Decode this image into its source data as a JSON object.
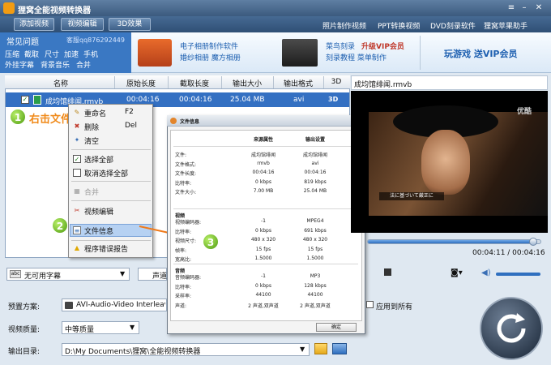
{
  "app": {
    "title": "狸窝全能视频转换器"
  },
  "menubar": {
    "tabs": [
      "添加视频",
      "视频编辑",
      "3D效果"
    ],
    "links": [
      "照片制作视频",
      "PPT转换视频",
      "DVD刻录软件",
      "狸窝苹果助手"
    ]
  },
  "banner": {
    "faq_title": "常见问题",
    "qq": "客服qq876292449",
    "faq_links": [
      "压缩",
      "截取",
      "尺寸",
      "加速",
      "手机"
    ],
    "faq_links2": [
      "外挂字幕",
      "背景音乐",
      "合并"
    ],
    "ad1_line1": "电子相册制作软件",
    "ad1_line2": "婚纱相册  魔方相册",
    "ad2_line1": "菜鸟刻录",
    "ad2_promo": "升级VIP会员",
    "ad2_line2": "刻录教程  菜单制作",
    "ad3": "玩游戏  送VIP会员"
  },
  "table": {
    "headers": [
      "名称",
      "原始长度",
      "截取长度",
      "输出大小",
      "输出格式",
      "3D"
    ],
    "rows": [
      {
        "name": "成均馆绯闻.rmvb",
        "orig_len": "00:04:16",
        "cut_len": "00:04:16",
        "size": "25.04 MB",
        "format": "avi",
        "threed": "3D"
      }
    ]
  },
  "context_menu": {
    "items": [
      {
        "label": "重命名",
        "shortcut": "F2",
        "icon": "rename-icon"
      },
      {
        "label": "删除",
        "shortcut": "Del",
        "icon": "delete-icon"
      },
      {
        "label": "清空",
        "shortcut": "",
        "icon": "clear-icon"
      },
      {
        "label": "选择全部",
        "shortcut": "",
        "icon": "checkbox-icon"
      },
      {
        "label": "取消选择全部",
        "shortcut": "",
        "icon": "checkbox-empty-icon"
      },
      {
        "label": "合并",
        "shortcut": "",
        "icon": "merge-icon"
      },
      {
        "label": "视频编辑",
        "shortcut": "",
        "icon": "scissors-icon"
      },
      {
        "label": "文件信息",
        "shortcut": "",
        "icon": "info-icon"
      },
      {
        "label": "程序错误报告",
        "shortcut": "",
        "icon": "warning-icon"
      }
    ]
  },
  "callouts": {
    "step1": "1",
    "step1_text": "右击文件",
    "step2": "2",
    "step3": "3"
  },
  "dialog": {
    "title": "文件信息",
    "col_source": "来源属性",
    "col_output": "输出设置",
    "general": [
      {
        "k": "文件:",
        "a": "成均馆绯闻",
        "b": "成均馆绯闻"
      },
      {
        "k": "文件格式:",
        "a": "rmvb",
        "b": "avi"
      },
      {
        "k": "文件长度:",
        "a": "00:04:16",
        "b": "00:04:16"
      },
      {
        "k": "比特率:",
        "a": "0 kbps",
        "b": "819 kbps"
      },
      {
        "k": "文件大小:",
        "a": "7.00 MB",
        "b": "25.04 MB"
      }
    ],
    "video_section": "视频",
    "video": [
      {
        "k": "视频编码器:",
        "a": "-1",
        "b": "MPEG4"
      },
      {
        "k": "比特率:",
        "a": "0 kbps",
        "b": "691 kbps"
      },
      {
        "k": "视频尺寸:",
        "a": "480 x 320",
        "b": "480 x 320"
      },
      {
        "k": "帧率:",
        "a": "15 fps",
        "b": "15 fps"
      },
      {
        "k": "宽高比:",
        "a": "1.5000",
        "b": "1.5000"
      }
    ],
    "audio_section": "音频",
    "audio": [
      {
        "k": "音频编码器:",
        "a": "-1",
        "b": "MP3"
      },
      {
        "k": "比特率:",
        "a": "0 kbps",
        "b": "128 kbps"
      },
      {
        "k": "采样率:",
        "a": "44100",
        "b": "44100"
      },
      {
        "k": "声道:",
        "a": "2 声道,双声道",
        "b": "2 声道,双声道"
      }
    ],
    "ok": "确定"
  },
  "preview": {
    "filename": "成均馆绯闻.rmvb",
    "watermark": "优酷",
    "subtitle": "法に基づいて厳正に",
    "time": "00:04:11 / 00:04:16",
    "progress": 0.98
  },
  "bottom": {
    "subtitle_select": "无可用字幕",
    "audio_label": "声道",
    "preset_label": "预置方案:",
    "preset_value": "AVI-Audio-Video Interleave",
    "apply_all": "应用到所有",
    "quality_label": "视频质量:",
    "quality_value": "中等质量",
    "output_label": "输出目录:",
    "output_value": "D:\\My Documents\\狸窝\\全能视频转换器"
  }
}
